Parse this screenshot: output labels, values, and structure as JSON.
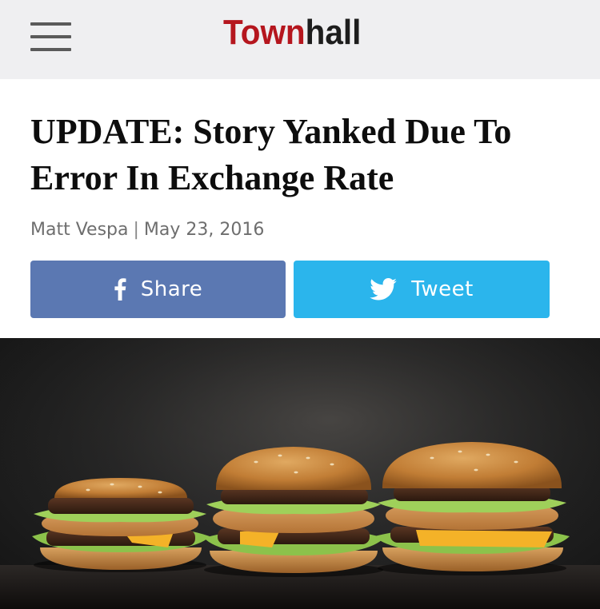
{
  "header": {
    "menu_icon": "hamburger-menu-icon",
    "logo": {
      "part1": "Town",
      "part2": "hall"
    },
    "colors": {
      "bar_bg": "#efeff1",
      "logo_red": "#b5161e",
      "logo_dark": "#1d1d1d"
    }
  },
  "article": {
    "title": "UPDATE: Story Yanked Due To Error In Exchange Rate",
    "author": "Matt Vespa",
    "separator": "|",
    "date": "May 23, 2016"
  },
  "share": {
    "facebook": {
      "label": "Share",
      "icon": "facebook-icon",
      "color": "#5b78b2"
    },
    "twitter": {
      "label": "Tweet",
      "icon": "twitter-bird-icon",
      "color": "#2bb5ec"
    }
  },
  "hero_image": {
    "subject": "three-burgers-photo"
  }
}
